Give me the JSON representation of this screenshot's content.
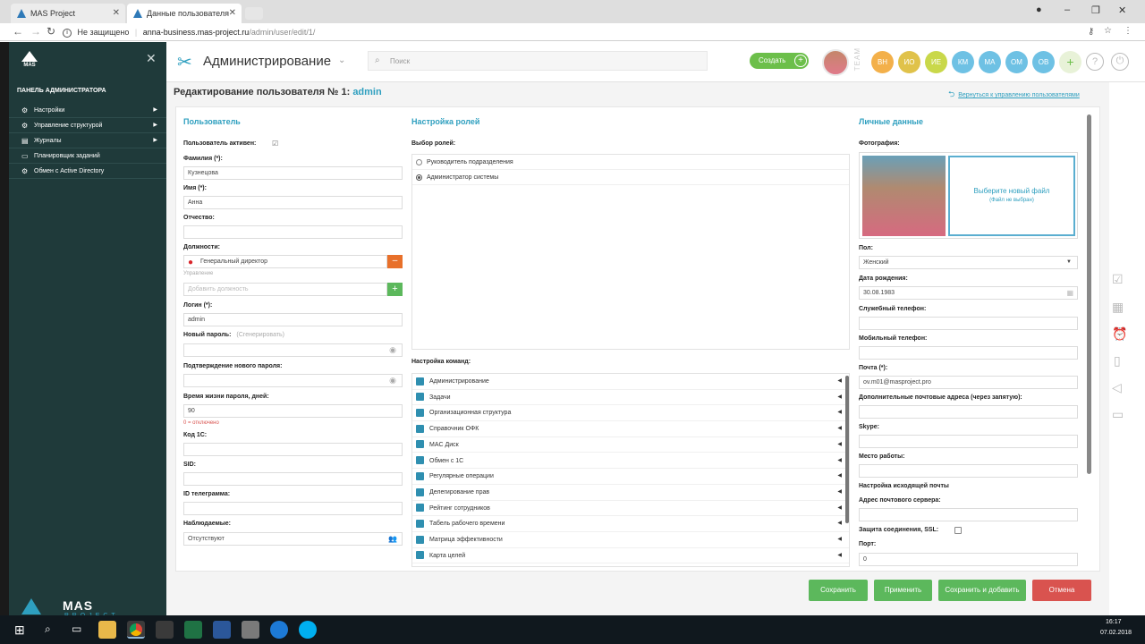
{
  "browser": {
    "tabs": [
      {
        "title": "MAS Project"
      },
      {
        "title": "Данные пользователя"
      }
    ],
    "security": "Не защищено",
    "url_host": "anna-business.mas-project.ru",
    "url_path": "/admin/user/edit/1/"
  },
  "sidebar": {
    "logo": "MAS",
    "panel_title": "ПАНЕЛЬ АДМИНИСТРАТОРА",
    "items": [
      {
        "label": "Настройки",
        "icon": "gear-icon",
        "has_arrow": true
      },
      {
        "label": "Управление структурой",
        "icon": "gear-icon",
        "has_arrow": true
      },
      {
        "label": "Журналы",
        "icon": "list-icon",
        "has_arrow": true
      },
      {
        "label": "Планировщик заданий",
        "icon": "document-icon",
        "has_arrow": false
      },
      {
        "label": "Обмен с Active Directory",
        "icon": "gear-icon",
        "has_arrow": false
      }
    ],
    "bottom_logo_main": "MAS",
    "bottom_logo_sub": "PROJECT"
  },
  "header": {
    "title": "Администрирование",
    "search_placeholder": "Поиск",
    "create_label": "Создать",
    "team_label": "TEAM",
    "avatars": [
      {
        "initials": "ВН",
        "color": "#f3b04a"
      },
      {
        "initials": "ИО",
        "color": "#d8d14a"
      },
      {
        "initials": "ИЕ",
        "color": "#c9d84a"
      },
      {
        "initials": "КМ",
        "color": "#6ec1e4"
      },
      {
        "initials": "МА",
        "color": "#6ec1e4"
      },
      {
        "initials": "ОМ",
        "color": "#6ec1e4"
      },
      {
        "initials": "ОВ",
        "color": "#6ec1e4"
      }
    ]
  },
  "page": {
    "title_prefix": "Редактирование пользователя № 1:",
    "title_user": "admin",
    "back_link": "Вернуться к управлению пользователями"
  },
  "user": {
    "section": "Пользователь",
    "active_label": "Пользователь активен:",
    "active_checked": true,
    "surname_label": "Фамилия (*):",
    "surname_value": "Кузнецова",
    "name_label": "Имя (*):",
    "name_value": "Анна",
    "patronymic_label": "Отчество:",
    "patronymic_value": "",
    "positions_label": "Должности:",
    "position_value": "Генеральный директор",
    "position_dept": "Управление",
    "add_position_placeholder": "Добавить должность",
    "login_label": "Логин (*):",
    "login_value": "admin",
    "new_password_label": "Новый пароль:",
    "generate_link": "(Сгенерировать)",
    "confirm_password_label": "Подтверждение нового пароля:",
    "password_life_label": "Время жизни пароля, дней:",
    "password_life_value": "90",
    "password_life_hint": "0 = отключено",
    "code1c_label": "Код 1С:",
    "sid_label": "SID:",
    "telegram_label": "ID телеграмма:",
    "observers_label": "Наблюдаемые:",
    "observers_value": "Отсутствуют"
  },
  "roles": {
    "section": "Настройка ролей",
    "select_label": "Выбор ролей:",
    "items": [
      {
        "label": "Руководитель подразделения",
        "checked": false
      },
      {
        "label": "Администратор системы",
        "checked": true
      }
    ],
    "teams_label": "Настройка команд:",
    "teams": [
      "Администрирование",
      "Задачи",
      "Организационная структура",
      "Справочник ОФК",
      "MAC Диск",
      "Обмен с 1С",
      "Регулярные операции",
      "Делегирование прав",
      "Рейтинг сотрудников",
      "Табель рабочего времени",
      "Матрица эффективности",
      "Карта целей"
    ]
  },
  "personal": {
    "section": "Личные данные",
    "photo_label": "Фотография:",
    "choose_file": "Выберите новый файл",
    "file_not_chosen": "(Файл не выбран)",
    "gender_label": "Пол:",
    "gender_value": "Женский",
    "birth_label": "Дата рождения:",
    "birth_value": "30.08.1983",
    "work_phone_label": "Служебный телефон:",
    "mobile_phone_label": "Мобильный телефон:",
    "email_label": "Почта (*):",
    "email_value": "ov.m01@masproject.pro",
    "extra_email_label": "Дополнительные почтовые адреса (через запятую):",
    "skype_label": "Skype:",
    "workplace_label": "Место работы:",
    "outgoing_label": "Настройка исходящей почты",
    "server_label": "Адрес почтового сервера:",
    "ssl_label": "Защита соединения, SSL:",
    "port_label": "Порт:",
    "port_value": "0"
  },
  "actions": {
    "save": "Сохранить",
    "apply": "Применить",
    "save_add": "Сохранить и добавить",
    "cancel": "Отмена"
  },
  "taskbar": {
    "time": "16:17",
    "date": "07.02.2018"
  },
  "colors": {
    "accent": "#2e9fbf",
    "sidebar": "#1f3a3a",
    "green": "#5cb85c",
    "red": "#d9534f",
    "orange": "#e8702a"
  }
}
